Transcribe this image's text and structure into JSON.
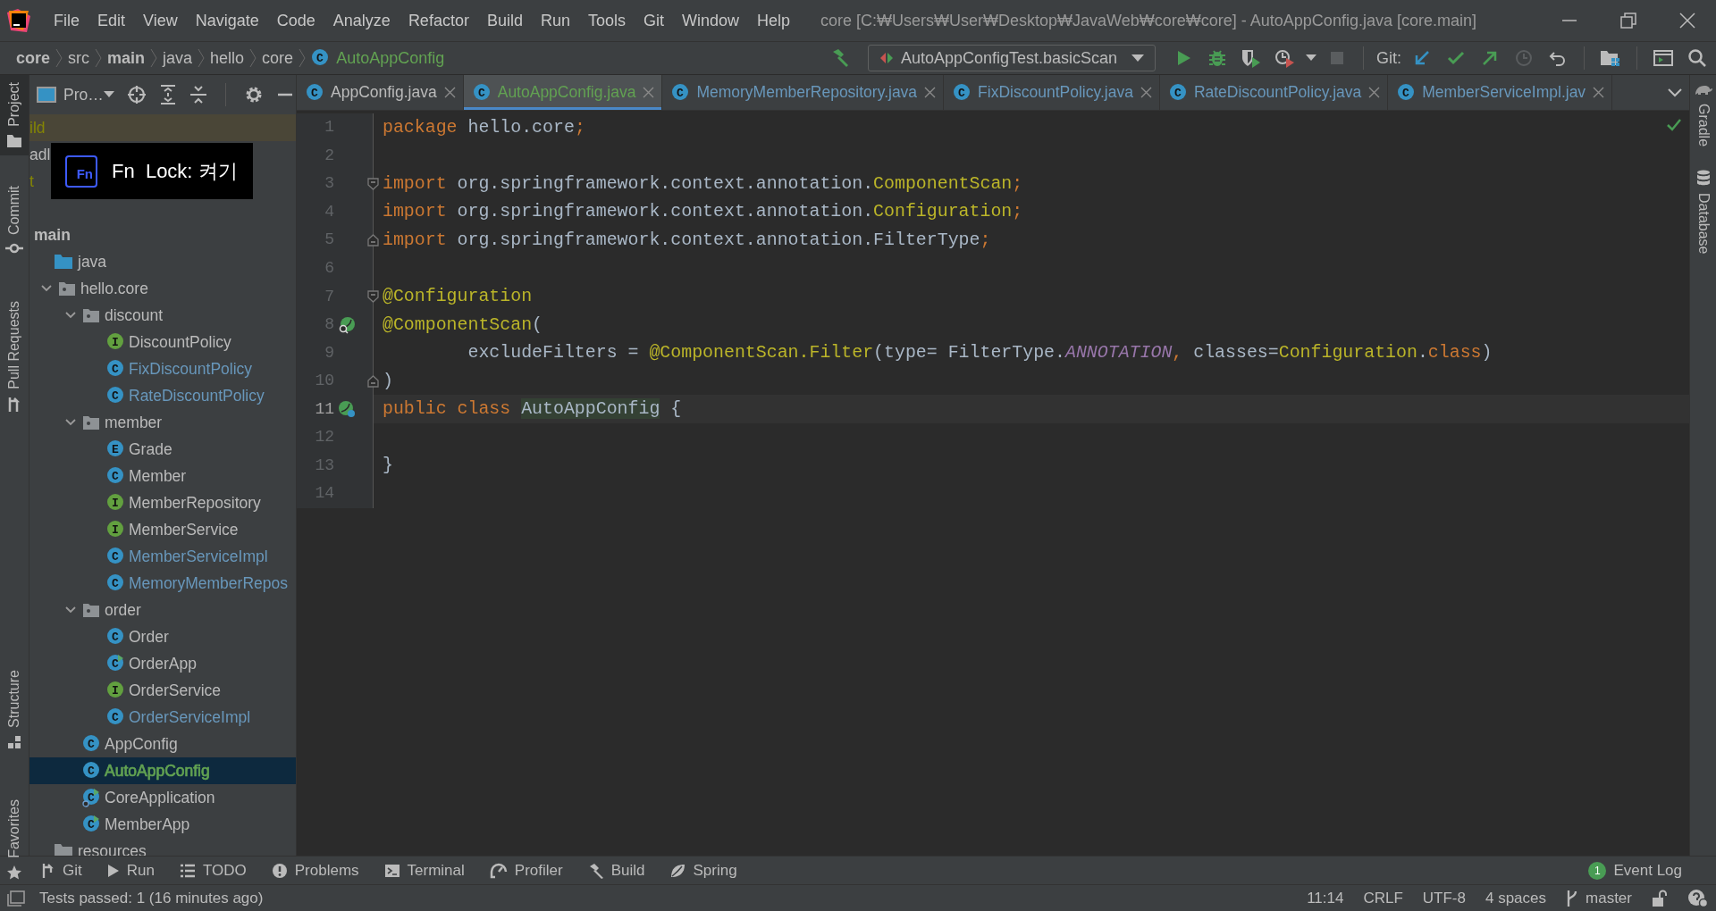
{
  "window": {
    "title": "core [C:₩Users₩User₩Desktop₩JavaWeb₩core₩core] - AutoAppConfig.java [core.main]"
  },
  "menu": [
    "File",
    "Edit",
    "View",
    "Navigate",
    "Code",
    "Analyze",
    "Refactor",
    "Build",
    "Run",
    "Tools",
    "Git",
    "Window",
    "Help"
  ],
  "breadcrumbs": [
    {
      "label": "core",
      "bold": true
    },
    {
      "label": "src",
      "bold": false
    },
    {
      "label": "main",
      "bold": true
    },
    {
      "label": "java",
      "bold": false
    },
    {
      "label": "hello",
      "bold": false
    },
    {
      "label": "core",
      "bold": false
    },
    {
      "label": "AutoAppConfig",
      "bold": false,
      "icon_letter": "C",
      "color": "#62a252"
    }
  ],
  "toolbar": {
    "run_config": "AutoAppConfigTest.basicScan",
    "git_label": "Git:",
    "stop_disabled": true,
    "history_disabled": true
  },
  "left_stripe": [
    {
      "label": "Project",
      "kind": "folder",
      "selected": true
    },
    {
      "label": "Commit",
      "kind": "commit",
      "selected": false
    },
    {
      "label": "Pull Requests",
      "kind": "pull",
      "selected": false
    },
    {
      "label": "Structure",
      "kind": "structure",
      "selected": false
    },
    {
      "label": "Favorites",
      "kind": "star",
      "selected": false
    }
  ],
  "right_stripe": [
    {
      "label": "Gradle",
      "kind": "gradle"
    },
    {
      "label": "Database",
      "kind": "database"
    }
  ],
  "project_panel": {
    "view_label": "Pro…",
    "cut_rows": [
      {
        "label": "ild",
        "color": "#848504",
        "highlighted": true
      },
      {
        "label": "adl",
        "color": "#bbbbbb",
        "highlighted": false
      },
      {
        "label": "t",
        "color": "#848504",
        "highlighted": false
      }
    ],
    "tree": [
      {
        "label": "main",
        "kind": "root",
        "children": [
          {
            "label": "java",
            "kind": "source-folder",
            "children": [
              {
                "label": "hello.core",
                "kind": "package",
                "expanded": true,
                "children": [
                  {
                    "label": "discount",
                    "kind": "package",
                    "expanded": true,
                    "children": [
                      {
                        "label": "DiscountPolicy",
                        "kind": "interface",
                        "icon_letter": "I",
                        "color": "#bbbbbb",
                        "selected": false
                      },
                      {
                        "label": "FixDiscountPolicy",
                        "kind": "class",
                        "icon_letter": "C",
                        "color": "#6897bb",
                        "selected": false
                      },
                      {
                        "label": "RateDiscountPolicy",
                        "kind": "class",
                        "icon_letter": "C",
                        "color": "#6897bb",
                        "selected": false
                      }
                    ]
                  },
                  {
                    "label": "member",
                    "kind": "package",
                    "expanded": true,
                    "children": [
                      {
                        "label": "Grade",
                        "kind": "enum",
                        "icon_letter": "E",
                        "color": "#bbbbbb",
                        "selected": false
                      },
                      {
                        "label": "Member",
                        "kind": "class",
                        "icon_letter": "C",
                        "color": "#bbbbbb",
                        "selected": false
                      },
                      {
                        "label": "MemberRepository",
                        "kind": "interface",
                        "icon_letter": "I",
                        "color": "#bbbbbb",
                        "selected": false
                      },
                      {
                        "label": "MemberService",
                        "kind": "interface",
                        "icon_letter": "I",
                        "color": "#bbbbbb",
                        "selected": false
                      },
                      {
                        "label": "MemberServiceImpl",
                        "kind": "class",
                        "icon_letter": "C",
                        "color": "#6897bb",
                        "selected": false
                      },
                      {
                        "label": "MemoryMemberRepos",
                        "kind": "class",
                        "icon_letter": "C",
                        "color": "#6897bb",
                        "selected": false
                      }
                    ]
                  },
                  {
                    "label": "order",
                    "kind": "package",
                    "expanded": true,
                    "children": [
                      {
                        "label": "Order",
                        "kind": "class",
                        "icon_letter": "C",
                        "color": "#bbbbbb",
                        "selected": false
                      },
                      {
                        "label": "OrderApp",
                        "kind": "class-runnable",
                        "icon_letter": "C",
                        "color": "#bbbbbb",
                        "selected": false
                      },
                      {
                        "label": "OrderService",
                        "kind": "interface",
                        "icon_letter": "I",
                        "color": "#bbbbbb",
                        "selected": false
                      },
                      {
                        "label": "OrderServiceImpl",
                        "kind": "class",
                        "icon_letter": "C",
                        "color": "#6897bb",
                        "selected": false
                      }
                    ]
                  },
                  {
                    "label": "AppConfig",
                    "kind": "class",
                    "icon_letter": "C",
                    "color": "#bbbbbb",
                    "selected": false
                  },
                  {
                    "label": "AutoAppConfig",
                    "kind": "class",
                    "icon_letter": "C",
                    "color": "#62a252",
                    "selected": true
                  },
                  {
                    "label": "CoreApplication",
                    "kind": "spring-app",
                    "icon_letter": "C",
                    "color": "#bbbbbb",
                    "selected": false
                  },
                  {
                    "label": "MemberApp",
                    "kind": "class-runnable",
                    "icon_letter": "C",
                    "color": "#bbbbbb",
                    "selected": false
                  }
                ]
              }
            ]
          },
          {
            "label": "resources",
            "kind": "folder"
          }
        ]
      }
    ]
  },
  "osd": {
    "icon_text": "Fn",
    "message": "Fn  Lock: 켜기"
  },
  "tabs": [
    {
      "label": "AppConfig.java",
      "icon_letter": "C",
      "color": "#bbbbbb",
      "selected": false
    },
    {
      "label": "AutoAppConfig.java",
      "icon_letter": "C",
      "color": "#62a252",
      "selected": true
    },
    {
      "label": "MemoryMemberRepository.java",
      "icon_letter": "C",
      "color": "#6897bb",
      "selected": false
    },
    {
      "label": "FixDiscountPolicy.java",
      "icon_letter": "C",
      "color": "#6897bb",
      "selected": false
    },
    {
      "label": "RateDiscountPolicy.java",
      "icon_letter": "C",
      "color": "#6897bb",
      "selected": false
    },
    {
      "label": "MemberServiceImpl.jav",
      "icon_letter": "C",
      "color": "#6897bb",
      "selected": false
    }
  ],
  "editor": {
    "lines": [
      {
        "number": "1",
        "tokens": [
          {
            "t": "package",
            "kind": "keyword"
          },
          {
            "t": " hello.core",
            "kind": "plain"
          },
          {
            "t": ";",
            "kind": "punct"
          }
        ]
      },
      {
        "number": "2"
      },
      {
        "number": "3",
        "fold_start": true,
        "tokens": [
          {
            "t": "import",
            "kind": "keyword"
          },
          {
            "t": " org.springframework.context.annotation.",
            "kind": "plain"
          },
          {
            "t": "ComponentScan",
            "kind": "annotation"
          },
          {
            "t": ";",
            "kind": "punct"
          }
        ]
      },
      {
        "number": "4",
        "tokens": [
          {
            "t": "import",
            "kind": "keyword"
          },
          {
            "t": " org.springframework.context.annotation.",
            "kind": "plain"
          },
          {
            "t": "Configuration",
            "kind": "annotation"
          },
          {
            "t": ";",
            "kind": "punct"
          }
        ]
      },
      {
        "number": "5",
        "fold_end": true,
        "tokens": [
          {
            "t": "import",
            "kind": "keyword"
          },
          {
            "t": " org.springframework.context.annotation.FilterType",
            "kind": "plain"
          },
          {
            "t": ";",
            "kind": "punct"
          }
        ]
      },
      {
        "number": "6"
      },
      {
        "number": "7",
        "fold_start": true,
        "tokens": [
          {
            "t": "@Configuration",
            "kind": "annotation"
          }
        ]
      },
      {
        "number": "8",
        "gutter": {
          "kind": "bean-search"
        },
        "tokens": [
          {
            "t": "@ComponentScan",
            "kind": "annotation"
          },
          {
            "t": "(",
            "kind": "plain"
          }
        ]
      },
      {
        "number": "9",
        "tokens": [
          {
            "t": "        excludeFilters = ",
            "kind": "plain"
          },
          {
            "t": "@ComponentScan.Filter",
            "kind": "annotation"
          },
          {
            "t": "(type= FilterType.",
            "kind": "plain"
          },
          {
            "t": "ANNOTATION",
            "kind": "constant"
          },
          {
            "t": ",",
            "kind": "punct"
          },
          {
            "t": " classes=",
            "kind": "plain"
          },
          {
            "t": "Configuration",
            "kind": "annotation"
          },
          {
            "t": ".",
            "kind": "plain"
          },
          {
            "t": "class",
            "kind": "keyword"
          },
          {
            "t": ")",
            "kind": "plain"
          }
        ]
      },
      {
        "number": "10",
        "fold_end": true,
        "tokens": [
          {
            "t": ")",
            "kind": "plain"
          }
        ]
      },
      {
        "number": "11",
        "gutter": {
          "kind": "bean"
        },
        "current": true,
        "tokens": [
          {
            "t": "public class",
            "kind": "keyword"
          },
          {
            "t": "AutoAppConfig",
            "kind": "decl"
          },
          {
            "t": " {",
            "kind": "plain"
          }
        ]
      },
      {
        "number": "12"
      },
      {
        "number": "13",
        "tokens": [
          {
            "t": "}",
            "kind": "plain"
          }
        ]
      },
      {
        "number": "14"
      }
    ]
  },
  "tool_windows": [
    {
      "label": "Git",
      "kind": "git"
    },
    {
      "label": "Run",
      "kind": "run"
    },
    {
      "label": "TODO",
      "kind": "todo"
    },
    {
      "label": "Problems",
      "kind": "problems"
    },
    {
      "label": "Terminal",
      "kind": "terminal"
    },
    {
      "label": "Profiler",
      "kind": "profiler"
    },
    {
      "label": "Build",
      "kind": "build"
    },
    {
      "label": "Spring",
      "kind": "spring"
    }
  ],
  "event_log": {
    "label": "Event Log",
    "count": "1"
  },
  "status_bar": {
    "message": "Tests passed: 1 (16 minutes ago)",
    "caret": "11:14",
    "line_separator": "CRLF",
    "encoding": "UTF-8",
    "indent": "4 spaces",
    "branch": "master"
  }
}
